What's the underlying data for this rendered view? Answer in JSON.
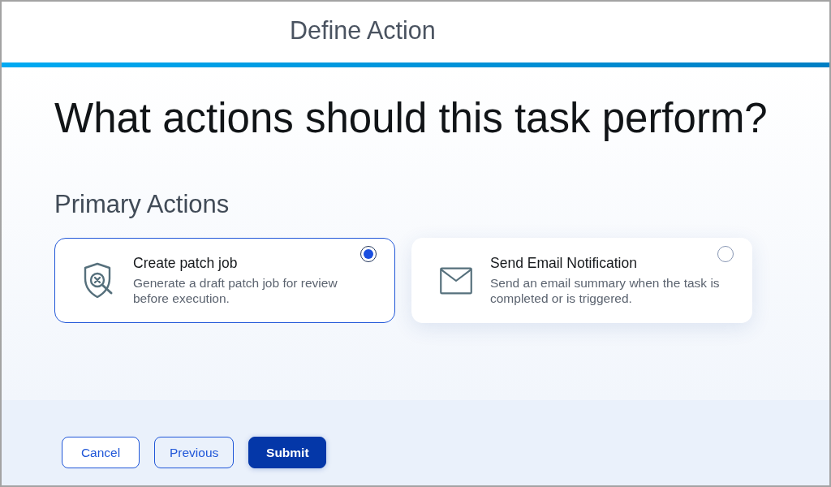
{
  "window": {
    "title": "Define Action"
  },
  "heading": "What actions should this task perform?",
  "section": {
    "title": "Primary Actions",
    "actions": [
      {
        "kind": "patch",
        "title": "Create patch job",
        "description": "Generate a draft patch job for review before execution.",
        "selected": true
      },
      {
        "kind": "email",
        "title": "Send Email Notification",
        "description": "Send an email summary when the task is completed or is triggered.",
        "selected": false
      }
    ]
  },
  "buttons": [
    {
      "label": "Cancel",
      "kind": "secondary"
    },
    {
      "label": "Previous",
      "kind": "tertiary"
    },
    {
      "label": "Submit",
      "kind": "primary"
    }
  ]
}
